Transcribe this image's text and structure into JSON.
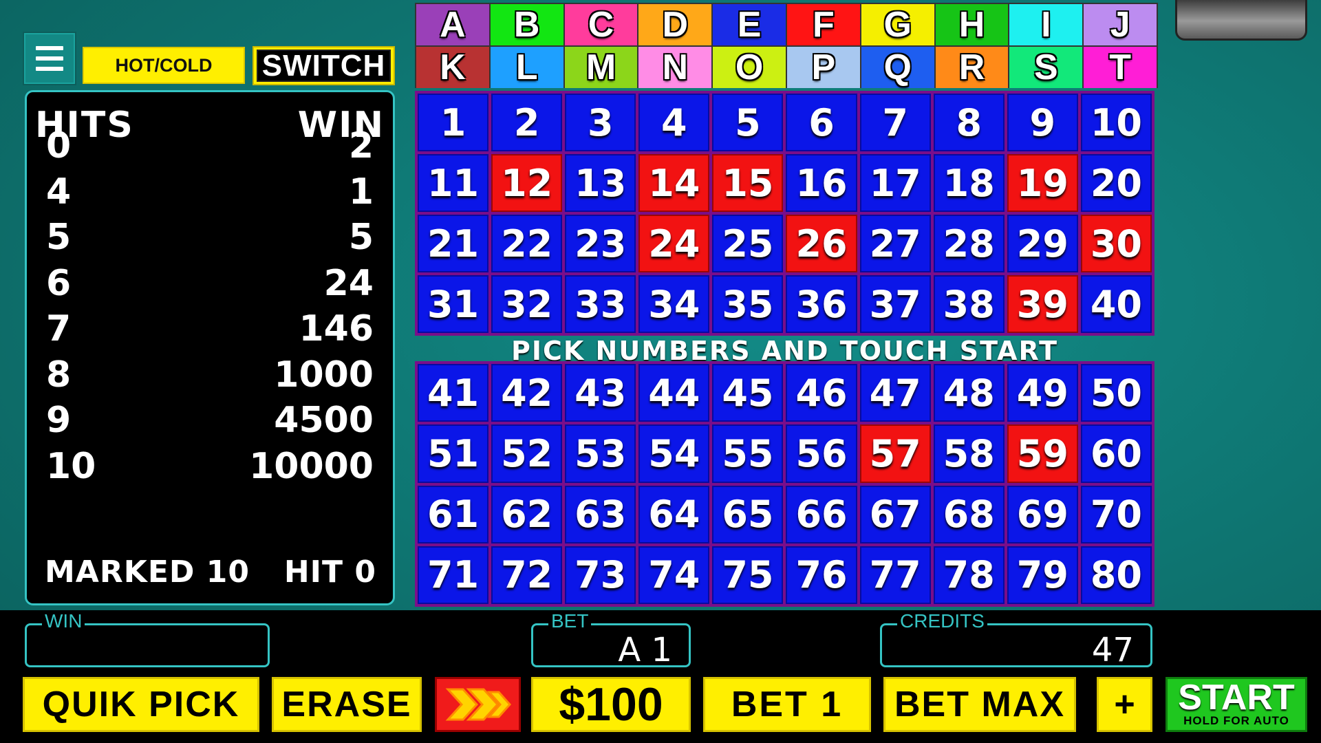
{
  "header": {
    "hotcold_label": "HOT/COLD",
    "switch_label": "SWITCH"
  },
  "paytable": {
    "hits_header": "HITS",
    "win_header": "WIN",
    "rows": [
      {
        "hits": "0",
        "win": "2"
      },
      {
        "hits": "4",
        "win": "1"
      },
      {
        "hits": "5",
        "win": "5"
      },
      {
        "hits": "6",
        "win": "24"
      },
      {
        "hits": "7",
        "win": "146"
      },
      {
        "hits": "8",
        "win": "1000"
      },
      {
        "hits": "9",
        "win": "4500"
      },
      {
        "hits": "10",
        "win": "10000"
      }
    ],
    "marked_label": "MARKED 10",
    "hit_label": "HIT 0"
  },
  "letters": [
    {
      "l": "A",
      "c": "#9a40b8"
    },
    {
      "l": "B",
      "c": "#12e612"
    },
    {
      "l": "C",
      "c": "#ff3c9c"
    },
    {
      "l": "D",
      "c": "#ffa818"
    },
    {
      "l": "E",
      "c": "#1a2ce6"
    },
    {
      "l": "F",
      "c": "#ff1414"
    },
    {
      "l": "G",
      "c": "#f5ef00"
    },
    {
      "l": "H",
      "c": "#16c416"
    },
    {
      "l": "I",
      "c": "#1ef0f0"
    },
    {
      "l": "J",
      "c": "#bc8cf0"
    },
    {
      "l": "K",
      "c": "#b83232"
    },
    {
      "l": "L",
      "c": "#1ea0ff"
    },
    {
      "l": "M",
      "c": "#8cd61a"
    },
    {
      "l": "N",
      "c": "#ff8ce6"
    },
    {
      "l": "O",
      "c": "#ccf012"
    },
    {
      "l": "P",
      "c": "#a8c8f0"
    },
    {
      "l": "Q",
      "c": "#1e5ef0"
    },
    {
      "l": "R",
      "c": "#ff8a18"
    },
    {
      "l": "S",
      "c": "#12e87a"
    },
    {
      "l": "T",
      "c": "#ff1ed6"
    }
  ],
  "board": {
    "instruction": "PICK NUMBERS AND TOUCH START",
    "hot_numbers": [
      12,
      14,
      15,
      19,
      24,
      26,
      30,
      39,
      57,
      59
    ],
    "cell_color": "#0b16e8",
    "hot_color": "#f21212"
  },
  "meters": {
    "win_label": "WIN",
    "win_value": "",
    "bet_label": "BET",
    "bet_value": "A 1",
    "credits_label": "CREDITS",
    "credits_value": "47"
  },
  "buttons": {
    "quik_pick": "QUIK PICK",
    "erase": "ERASE",
    "denom": "$100",
    "bet1": "BET 1",
    "bet_max": "BET MAX",
    "plus": "+",
    "start": "START",
    "start_sub": "HOLD FOR AUTO"
  },
  "icons": {
    "menu": "hamburger-menu-icon",
    "speed": "fast-forward-chevrons-icon"
  }
}
